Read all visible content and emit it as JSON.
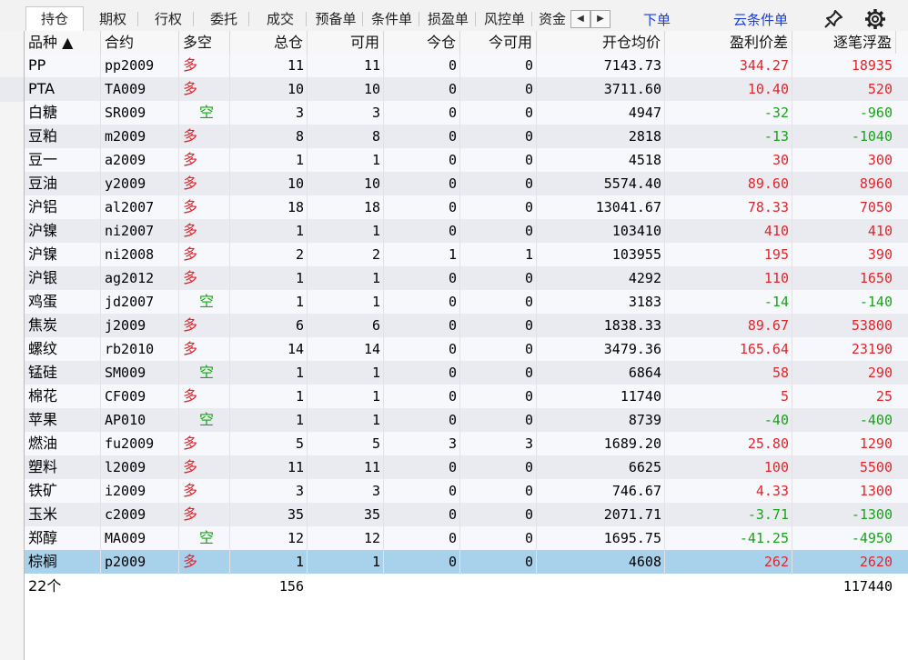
{
  "tabs": [
    {
      "label": "持仓",
      "active": true
    },
    {
      "label": "期权"
    },
    {
      "label": "行权"
    },
    {
      "label": "委托"
    },
    {
      "label": "成交"
    },
    {
      "label": "预备单"
    },
    {
      "label": "条件单"
    },
    {
      "label": "损盈单"
    },
    {
      "label": "风控单"
    },
    {
      "label": "资金"
    }
  ],
  "scroll_left": "◀",
  "scroll_right": "▶",
  "links": {
    "order": "下单",
    "cloud_order": "云条件单"
  },
  "icons": {
    "pin": "pin-icon",
    "settings": "gear-icon"
  },
  "columns": [
    "品种 ▲",
    "合约",
    "多空",
    "总仓",
    "可用",
    "今仓",
    "今可用",
    "开仓均价",
    "盈利价差",
    "逐笔浮盈"
  ],
  "rows": [
    {
      "name": "PP",
      "contract": "pp2009",
      "dir": "多",
      "total": "11",
      "avail": "11",
      "today": "0",
      "today_avail": "0",
      "avg": "7143.73",
      "diff": "344.27",
      "float": "18935",
      "pos": true
    },
    {
      "name": "PTA",
      "contract": "TA009",
      "dir": "多",
      "total": "10",
      "avail": "10",
      "today": "0",
      "today_avail": "0",
      "avg": "3711.60",
      "diff": "10.40",
      "float": "520",
      "pos": true
    },
    {
      "name": "白糖",
      "contract": "SR009",
      "dir": "空",
      "total": "3",
      "avail": "3",
      "today": "0",
      "today_avail": "0",
      "avg": "4947",
      "diff": "-32",
      "float": "-960",
      "pos": false
    },
    {
      "name": "豆粕",
      "contract": "m2009",
      "dir": "多",
      "total": "8",
      "avail": "8",
      "today": "0",
      "today_avail": "0",
      "avg": "2818",
      "diff": "-13",
      "float": "-1040",
      "pos": false
    },
    {
      "name": "豆一",
      "contract": "a2009",
      "dir": "多",
      "total": "1",
      "avail": "1",
      "today": "0",
      "today_avail": "0",
      "avg": "4518",
      "diff": "30",
      "float": "300",
      "pos": true
    },
    {
      "name": "豆油",
      "contract": "y2009",
      "dir": "多",
      "total": "10",
      "avail": "10",
      "today": "0",
      "today_avail": "0",
      "avg": "5574.40",
      "diff": "89.60",
      "float": "8960",
      "pos": true
    },
    {
      "name": "沪铝",
      "contract": "al2007",
      "dir": "多",
      "total": "18",
      "avail": "18",
      "today": "0",
      "today_avail": "0",
      "avg": "13041.67",
      "diff": "78.33",
      "float": "7050",
      "pos": true
    },
    {
      "name": "沪镍",
      "contract": "ni2007",
      "dir": "多",
      "total": "1",
      "avail": "1",
      "today": "0",
      "today_avail": "0",
      "avg": "103410",
      "diff": "410",
      "float": "410",
      "pos": true
    },
    {
      "name": "沪镍",
      "contract": "ni2008",
      "dir": "多",
      "total": "2",
      "avail": "2",
      "today": "1",
      "today_avail": "1",
      "avg": "103955",
      "diff": "195",
      "float": "390",
      "pos": true
    },
    {
      "name": "沪银",
      "contract": "ag2012",
      "dir": "多",
      "total": "1",
      "avail": "1",
      "today": "0",
      "today_avail": "0",
      "avg": "4292",
      "diff": "110",
      "float": "1650",
      "pos": true
    },
    {
      "name": "鸡蛋",
      "contract": "jd2007",
      "dir": "空",
      "total": "1",
      "avail": "1",
      "today": "0",
      "today_avail": "0",
      "avg": "3183",
      "diff": "-14",
      "float": "-140",
      "pos": false
    },
    {
      "name": "焦炭",
      "contract": "j2009",
      "dir": "多",
      "total": "6",
      "avail": "6",
      "today": "0",
      "today_avail": "0",
      "avg": "1838.33",
      "diff": "89.67",
      "float": "53800",
      "pos": true
    },
    {
      "name": "螺纹",
      "contract": "rb2010",
      "dir": "多",
      "total": "14",
      "avail": "14",
      "today": "0",
      "today_avail": "0",
      "avg": "3479.36",
      "diff": "165.64",
      "float": "23190",
      "pos": true
    },
    {
      "name": "锰硅",
      "contract": "SM009",
      "dir": "空",
      "total": "1",
      "avail": "1",
      "today": "0",
      "today_avail": "0",
      "avg": "6864",
      "diff": "58",
      "float": "290",
      "pos": true
    },
    {
      "name": "棉花",
      "contract": "CF009",
      "dir": "多",
      "total": "1",
      "avail": "1",
      "today": "0",
      "today_avail": "0",
      "avg": "11740",
      "diff": "5",
      "float": "25",
      "pos": true
    },
    {
      "name": "苹果",
      "contract": "AP010",
      "dir": "空",
      "total": "1",
      "avail": "1",
      "today": "0",
      "today_avail": "0",
      "avg": "8739",
      "diff": "-40",
      "float": "-400",
      "pos": false
    },
    {
      "name": "燃油",
      "contract": "fu2009",
      "dir": "多",
      "total": "5",
      "avail": "5",
      "today": "3",
      "today_avail": "3",
      "avg": "1689.20",
      "diff": "25.80",
      "float": "1290",
      "pos": true
    },
    {
      "name": "塑料",
      "contract": "l2009",
      "dir": "多",
      "total": "11",
      "avail": "11",
      "today": "0",
      "today_avail": "0",
      "avg": "6625",
      "diff": "100",
      "float": "5500",
      "pos": true
    },
    {
      "name": "铁矿",
      "contract": "i2009",
      "dir": "多",
      "total": "3",
      "avail": "3",
      "today": "0",
      "today_avail": "0",
      "avg": "746.67",
      "diff": "4.33",
      "float": "1300",
      "pos": true
    },
    {
      "name": "玉米",
      "contract": "c2009",
      "dir": "多",
      "total": "35",
      "avail": "35",
      "today": "0",
      "today_avail": "0",
      "avg": "2071.71",
      "diff": "-3.71",
      "float": "-1300",
      "pos": false
    },
    {
      "name": "郑醇",
      "contract": "MA009",
      "dir": "空",
      "total": "12",
      "avail": "12",
      "today": "0",
      "today_avail": "0",
      "avg": "1695.75",
      "diff": "-41.25",
      "float": "-4950",
      "pos": false
    },
    {
      "name": "棕榈",
      "contract": "p2009",
      "dir": "多",
      "total": "1",
      "avail": "1",
      "today": "0",
      "today_avail": "0",
      "avg": "4608",
      "diff": "262",
      "float": "2620",
      "pos": true,
      "selected": true
    }
  ],
  "summary": {
    "count": "22个",
    "total": "156",
    "float": "117440"
  },
  "colors": {
    "long": "#e0262b",
    "short": "#1aa31a",
    "profit": "#e0262b",
    "loss": "#1aa31a",
    "selected": "#a8d2ec",
    "link": "#1a3ed6"
  }
}
